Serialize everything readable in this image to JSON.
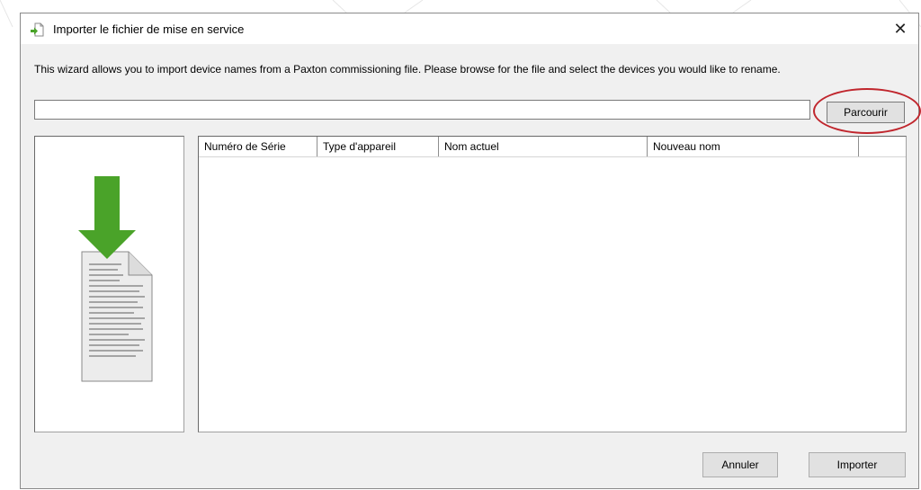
{
  "window": {
    "title": "Importer le fichier de mise en service",
    "close_glyph": "✕"
  },
  "intro_text": "This wizard allows you to import device names from a Paxton commissioning file. Please browse for the file and select the devices you would like to rename.",
  "file_path": {
    "value": "",
    "placeholder": ""
  },
  "buttons": {
    "browse": "Parcourir",
    "cancel": "Annuler",
    "import": "Importer"
  },
  "table": {
    "columns": [
      "Numéro de Série",
      "Type d'appareil",
      "Nom actuel",
      "Nouveau nom"
    ],
    "rows": []
  },
  "icons": {
    "title": "import-file-icon",
    "illustration": "document-download-icon",
    "close": "close-icon"
  },
  "colors": {
    "highlight": "#c0262d",
    "arrow": "#4aa329",
    "dialog_bg": "#f0f0f0"
  }
}
